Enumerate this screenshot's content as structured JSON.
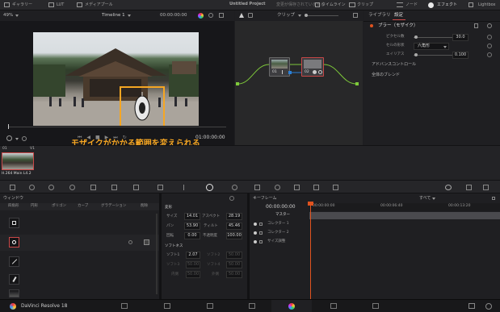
{
  "topbar": {
    "gallery": "ギャラリー",
    "lut": "LUT",
    "media_pool": "メディアプール",
    "project_title": "Untitled Project",
    "status": "変更が保存されていません",
    "timeline_tab": "タイムライン",
    "clips": "クリップ",
    "nodes": "ノード",
    "effects": "エフェクト",
    "lightbox": "Lightbox"
  },
  "viewer": {
    "zoom": "49%",
    "timeline_name": "Timeline 1",
    "timecode_top": "00:00:00:00",
    "timecode_bottom": "01:00:00:00"
  },
  "annotation": "モザイクがかかる範囲を変えられる",
  "nodes": {
    "mode": "クリップ",
    "node1_label": "01",
    "node2_label": "02"
  },
  "right": {
    "tab_library": "ライブラリ",
    "tab_settings": "設定",
    "fx_name": "ブラー（モザイク）",
    "rows": [
      {
        "label": "ピクセル数",
        "value": "30.0"
      },
      {
        "label": "セルの形状",
        "value": "六角形"
      },
      {
        "label": "エイリアス",
        "value": "0.100"
      }
    ],
    "advanced": "アドバンスコントロール",
    "global_blend": "全体のブレンド"
  },
  "clip": {
    "index": "01",
    "track": "V1",
    "codec": "H.264 Main L4.2"
  },
  "window": {
    "title": "ウィンドウ",
    "shape_quad": "四角形",
    "shape_circle": "円形",
    "shape_polygon": "ポリゴン",
    "shape_curve": "カーブ",
    "shape_gradient": "グラデーション",
    "delete": "削除"
  },
  "transform": {
    "section": "変形",
    "size_label": "サイズ",
    "size": "14.01",
    "aspect_label": "アスペクト",
    "aspect": "28.19",
    "pan_label": "パン",
    "pan": "53.90",
    "tilt_label": "ティルト",
    "tilt": "45.46",
    "rotate_label": "回転",
    "rotate": "0.00",
    "opacity_label": "不透明度",
    "opacity": "100.00",
    "soft_section": "ソフトネス",
    "soft1_label": "ソフト1",
    "soft1": "2.07",
    "soft2_label": "ソフト2",
    "soft2": "50.00",
    "soft3_label": "ソフト3",
    "soft3": "50.00",
    "soft4_label": "ソフト4",
    "soft4": "50.00",
    "inside_label": "内側",
    "inside": "50.00",
    "outside_label": "外側",
    "outside": "50.00"
  },
  "keyframes": {
    "title": "キーフレーム",
    "filter": "すべて",
    "tc_current": "00:00:00:00",
    "tc_1": "00:00:00:00",
    "tc_2": "00:00:06:40",
    "tc_3": "00:00:13:20",
    "track_master": "マスター",
    "track_corrector1": "コレクター 1",
    "track_corrector2": "コレクター 2",
    "track_resize": "サイズ調整"
  },
  "bottom": {
    "app": "DaVinci Resolve 18"
  },
  "colors": {
    "accent": "#e0531f",
    "selected": "#c94848",
    "node_green": "#7ec93a",
    "node_blue": "#2a7fd6",
    "annotation": "#f5a623"
  }
}
